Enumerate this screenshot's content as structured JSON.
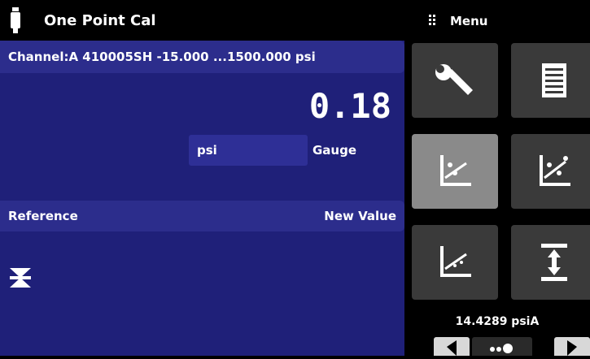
{
  "header": {
    "title": "One Point Cal",
    "title_icon": "transducer-icon",
    "menu_label": "Menu",
    "menu_icon": "drag-handle-icon"
  },
  "channel": {
    "info": "Channel:A 410005SH  -15.000 ...1500.000 psi"
  },
  "reading": {
    "value": "0.18",
    "unit": "psi",
    "mode": "Gauge"
  },
  "calibration": {
    "reference_label": "Reference",
    "new_value_label": "New Value"
  },
  "menu_tiles": [
    {
      "name": "settings-wrench-icon",
      "active": false
    },
    {
      "name": "document-icon",
      "active": false
    },
    {
      "name": "calibration-icon",
      "active": true
    },
    {
      "name": "multi-point-cal-icon",
      "active": false
    },
    {
      "name": "linearity-cal-icon",
      "active": false
    },
    {
      "name": "zero-span-icon",
      "active": false
    }
  ],
  "status": {
    "barometric": "14.4289 psiA"
  },
  "colors": {
    "panel": "#1f2079",
    "panel_header": "#2c2d8c",
    "tile": "#3a3a3a",
    "tile_active": "#8a8a8a"
  }
}
